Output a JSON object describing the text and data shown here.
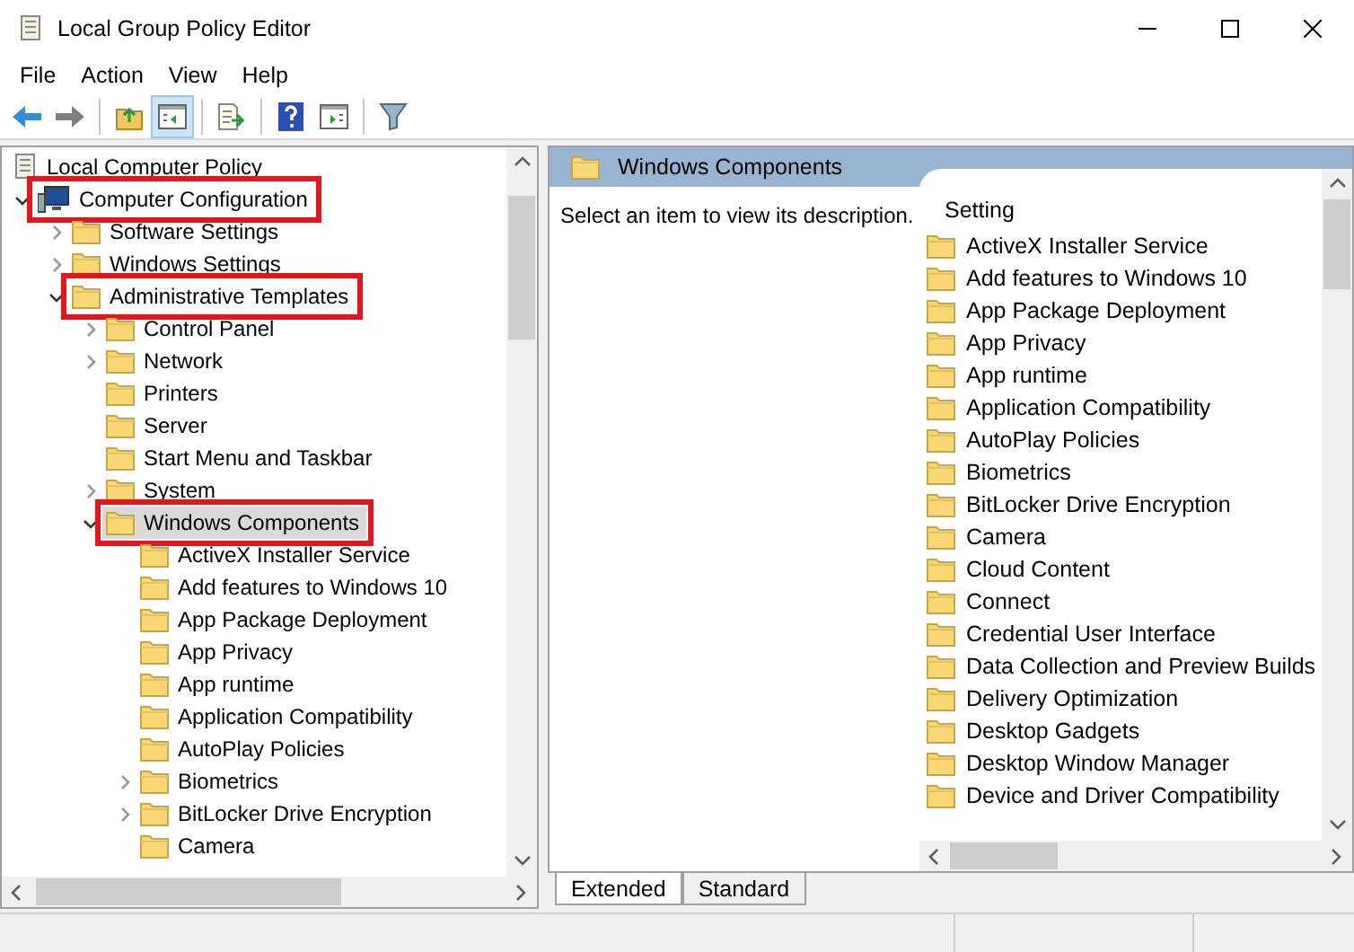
{
  "window": {
    "title": "Local Group Policy Editor"
  },
  "menu": [
    "File",
    "Action",
    "View",
    "Help"
  ],
  "toolbar": [
    {
      "kind": "back",
      "pressed": false
    },
    {
      "kind": "forward",
      "pressed": false
    },
    {
      "kind": "sep"
    },
    {
      "kind": "up",
      "pressed": false
    },
    {
      "kind": "tree",
      "pressed": true
    },
    {
      "kind": "sep"
    },
    {
      "kind": "export",
      "pressed": false
    },
    {
      "kind": "sep"
    },
    {
      "kind": "help",
      "pressed": false
    },
    {
      "kind": "pane",
      "pressed": false
    },
    {
      "kind": "sep"
    },
    {
      "kind": "filter",
      "pressed": false
    }
  ],
  "tree": [
    {
      "label": "Local Computer Policy",
      "kind": "policy",
      "selected": false,
      "highlighted": false,
      "children": [
        {
          "label": "Computer Configuration",
          "kind": "computer",
          "expanded": true,
          "selected": false,
          "highlighted": true,
          "children": [
            {
              "label": "Software Settings",
              "kind": "folder",
              "expanded": false,
              "selected": false,
              "highlighted": false
            },
            {
              "label": "Windows Settings",
              "kind": "folder",
              "expanded": false,
              "selected": false,
              "highlighted": false
            },
            {
              "label": "Administrative Templates",
              "kind": "folder",
              "expanded": true,
              "selected": false,
              "highlighted": true,
              "children": [
                {
                  "label": "Control Panel",
                  "kind": "folder",
                  "expanded": false,
                  "selected": false,
                  "highlighted": false
                },
                {
                  "label": "Network",
                  "kind": "folder",
                  "expanded": false,
                  "selected": false,
                  "highlighted": false
                },
                {
                  "label": "Printers",
                  "kind": "folder",
                  "selected": false,
                  "highlighted": false
                },
                {
                  "label": "Server",
                  "kind": "folder",
                  "selected": false,
                  "highlighted": false
                },
                {
                  "label": "Start Menu and Taskbar",
                  "kind": "folder",
                  "selected": false,
                  "highlighted": false
                },
                {
                  "label": "System",
                  "kind": "folder",
                  "expanded": false,
                  "selected": false,
                  "highlighted": false
                },
                {
                  "label": "Windows Components",
                  "kind": "folder",
                  "expanded": true,
                  "selected": true,
                  "highlighted": true,
                  "children": [
                    {
                      "label": "ActiveX Installer Service",
                      "kind": "folder",
                      "selected": false,
                      "highlighted": false
                    },
                    {
                      "label": "Add features to Windows 10",
                      "kind": "folder",
                      "selected": false,
                      "highlighted": false
                    },
                    {
                      "label": "App Package Deployment",
                      "kind": "folder",
                      "selected": false,
                      "highlighted": false
                    },
                    {
                      "label": "App Privacy",
                      "kind": "folder",
                      "selected": false,
                      "highlighted": false
                    },
                    {
                      "label": "App runtime",
                      "kind": "folder",
                      "selected": false,
                      "highlighted": false
                    },
                    {
                      "label": "Application Compatibility",
                      "kind": "folder",
                      "selected": false,
                      "highlighted": false
                    },
                    {
                      "label": "AutoPlay Policies",
                      "kind": "folder",
                      "selected": false,
                      "highlighted": false
                    },
                    {
                      "label": "Biometrics",
                      "kind": "folder",
                      "expanded": false,
                      "selected": false,
                      "highlighted": false
                    },
                    {
                      "label": "BitLocker Drive Encryption",
                      "kind": "folder",
                      "expanded": false,
                      "selected": false,
                      "highlighted": false
                    },
                    {
                      "label": "Camera",
                      "kind": "folder",
                      "selected": false,
                      "highlighted": false
                    }
                  ]
                }
              ]
            }
          ]
        }
      ]
    }
  ],
  "details": {
    "header": "Windows Components",
    "description": "Select an item to view its description.",
    "column": "Setting",
    "items": [
      "ActiveX Installer Service",
      "Add features to Windows 10",
      "App Package Deployment",
      "App Privacy",
      "App runtime",
      "Application Compatibility",
      "AutoPlay Policies",
      "Biometrics",
      "BitLocker Drive Encryption",
      "Camera",
      "Cloud Content",
      "Connect",
      "Credential User Interface",
      "Data Collection and Preview Builds",
      "Delivery Optimization",
      "Desktop Gadgets",
      "Desktop Window Manager",
      "Device and Driver Compatibility"
    ]
  },
  "tabs": [
    {
      "label": "Extended",
      "selected": true
    },
    {
      "label": "Standard",
      "selected": false
    }
  ]
}
